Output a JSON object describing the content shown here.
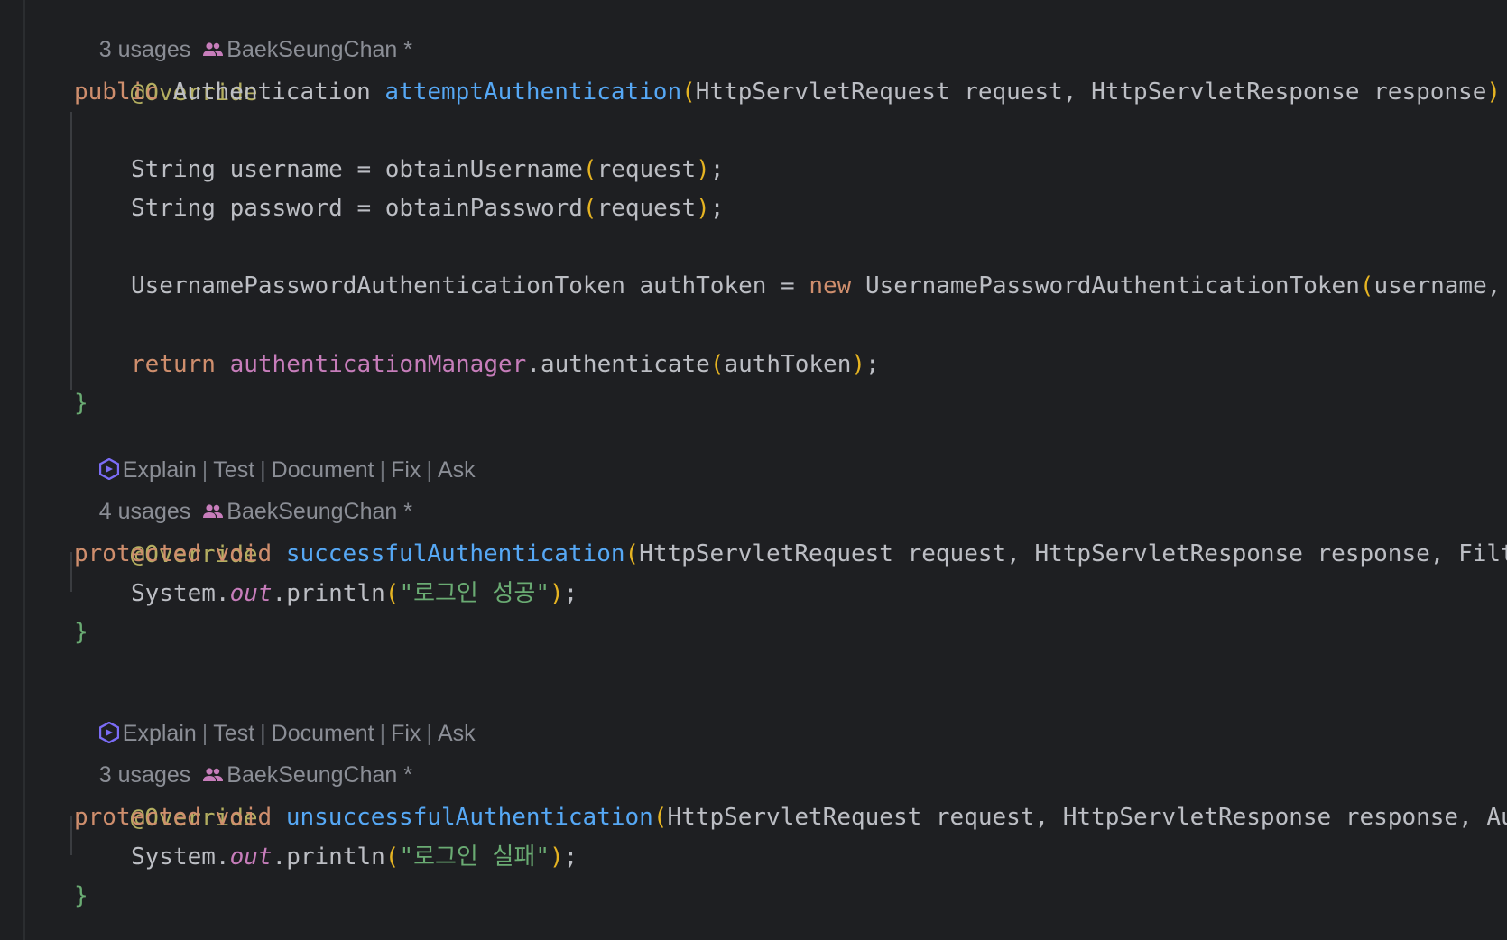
{
  "blocks": [
    {
      "usages": "3 usages",
      "author": "BaekSeungChan *",
      "annotation": "@Override",
      "sig": {
        "mod": "public",
        "ret": "Authentication",
        "name": "attemptAuthentication",
        "params": "HttpServletRequest request, HttpServletResponse response",
        "open": "(",
        "close": ")"
      },
      "body": {
        "l1": {
          "pre": "String username = obtainUsername",
          "open": "(",
          "arg": "request",
          "close": ")",
          "end": ";"
        },
        "l2": {
          "pre": "String password = obtainPassword",
          "open": "(",
          "arg": "request",
          "close": ")",
          "end": ";"
        },
        "l3": {
          "pre": "UsernamePasswordAuthenticationToken authToken = ",
          "kw": "new",
          "post": " UsernamePasswordAuthenticationToken",
          "open": "(",
          "arg": "username,"
        },
        "l4": {
          "kw": "return",
          "field": "authenticationManager",
          "post": ".authenticate",
          "open": "(",
          "arg": "authToken",
          "close": ")",
          "end": ";"
        }
      },
      "closing": "}"
    },
    {
      "usages": "4 usages",
      "author": "BaekSeungChan *",
      "annotation": "@Override",
      "sig": {
        "mod": "protected",
        "ret": "void",
        "name": "successfulAuthentication",
        "params": "HttpServletRequest request, HttpServletResponse response, Filt",
        "open": "("
      },
      "body": {
        "pre": "System.",
        "field": "out",
        "post": ".println",
        "open": "(",
        "str": "\"로그인 성공\"",
        "close": ")",
        "end": ";"
      },
      "closing": "}"
    },
    {
      "usages": "3 usages",
      "author": "BaekSeungChan *",
      "annotation": "@Override",
      "sig": {
        "mod": "protected",
        "ret": "void",
        "name": "unsuccessfulAuthentication",
        "params": "HttpServletRequest request, HttpServletResponse response, Au",
        "open": "("
      },
      "body": {
        "pre": "System.",
        "field": "out",
        "post": ".println",
        "open": "(",
        "str": "\"로그인 실패\"",
        "close": ")",
        "end": ";"
      },
      "closing": "}"
    }
  ],
  "ai_lens": {
    "actions": [
      "Explain",
      "Test",
      "Document",
      "Fix",
      "Ask"
    ],
    "separator": "|"
  },
  "colors": {
    "background": "#1e1f22",
    "keyword": "#cf8e6d",
    "annotation": "#b3ae60",
    "function": "#56a8f5",
    "field": "#c77dbb",
    "string": "#6aab73",
    "hint": "#8b8e96",
    "ai_icon": "#7b6cf6",
    "people_icon": "#c77dbb"
  },
  "icons": {
    "author": "people-icon",
    "ai": "ai-assistant-icon"
  }
}
